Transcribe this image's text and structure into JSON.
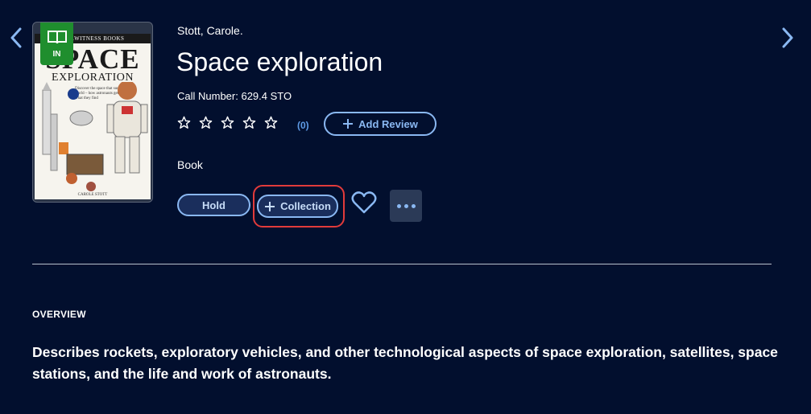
{
  "nav": {
    "prev_icon": "chevron-left-icon",
    "next_icon": "chevron-right-icon"
  },
  "cover": {
    "series": "EYEWITNESS BOOKS",
    "title_line1": "SPACE",
    "title_line2": "EXPLORATION",
    "blurb": "Discover the space that surrounds our world – how astronauts get there and what they find",
    "author": "CAROLE STOTT"
  },
  "availability": {
    "icon": "open-book-icon",
    "label": "IN",
    "color": "#1f8e2e"
  },
  "item": {
    "author": "Stott, Carole.",
    "title": "Space exploration",
    "call_number": "Call Number: 629.4 STO",
    "format": "Book"
  },
  "rating": {
    "stars": 5,
    "filled": 0,
    "review_count": "(0)"
  },
  "actions": {
    "add_review": "Add Review",
    "hold": "Hold",
    "collection": "Collection",
    "favorite_icon": "heart-icon",
    "more_icon": "more-icon"
  },
  "overview": {
    "heading": "OVERVIEW",
    "text": "Describes rockets, exploratory vehicles, and other technological aspects of space exploration, satellites, space stations, and the life and work of astronauts."
  },
  "colors": {
    "background": "#020f2e",
    "accent": "#8ab8f2",
    "highlight": "#e23b3b"
  }
}
